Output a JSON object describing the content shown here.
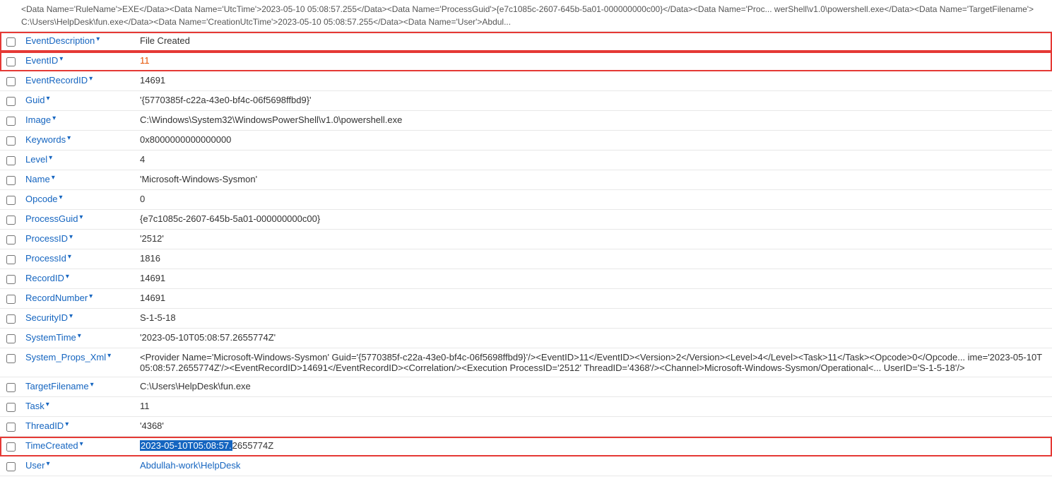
{
  "top_xml": {
    "text": "<Data Name='RuleName'>EXE</Data><Data Name='UtcTime'>2023-05-10 05:08:57.255</Data><Data Name='ProcessGuid'>{e7c1085c-2607-645b-5a01-000000000c00}</Data><Data Name='Proc... werShell\\v1.0\\powershell.exe</Data><Data Name='TargetFilename'>C:\\Users\\HelpDesk\\fun.exe</Data><Data Name='CreationUtcTime'>2023-05-10 05:08:57.255</Data><Data Name='User'>Abdul..."
  },
  "rows": [
    {
      "id": "event-description",
      "name": "EventDescription",
      "value": "File Created",
      "valueClass": "",
      "highlighted": true,
      "checkbox": false
    },
    {
      "id": "event-id",
      "name": "EventID",
      "value": "11",
      "valueClass": "orange",
      "highlighted": true,
      "checkbox": false
    },
    {
      "id": "event-record-id",
      "name": "EventRecordID",
      "value": "14691",
      "valueClass": "",
      "highlighted": false,
      "checkbox": false
    },
    {
      "id": "guid",
      "name": "Guid",
      "value": "'{5770385f-c22a-43e0-bf4c-06f5698ffbd9}'",
      "valueClass": "",
      "highlighted": false,
      "checkbox": false
    },
    {
      "id": "image",
      "name": "Image",
      "value": "C:\\Windows\\System32\\WindowsPowerShell\\v1.0\\powershell.exe",
      "valueClass": "",
      "highlighted": false,
      "checkbox": false
    },
    {
      "id": "keywords",
      "name": "Keywords",
      "value": "0x8000000000000000",
      "valueClass": "",
      "highlighted": false,
      "checkbox": false
    },
    {
      "id": "level",
      "name": "Level",
      "value": "4",
      "valueClass": "",
      "highlighted": false,
      "checkbox": false
    },
    {
      "id": "name",
      "name": "Name",
      "value": "'Microsoft-Windows-Sysmon'",
      "valueClass": "",
      "highlighted": false,
      "checkbox": false
    },
    {
      "id": "opcode",
      "name": "Opcode",
      "value": "0",
      "valueClass": "",
      "highlighted": false,
      "checkbox": false
    },
    {
      "id": "process-guid",
      "name": "ProcessGuid",
      "value": "{e7c1085c-2607-645b-5a01-000000000c00}",
      "valueClass": "",
      "highlighted": false,
      "checkbox": false
    },
    {
      "id": "process-id",
      "name": "ProcessID",
      "value": "'2512'",
      "valueClass": "",
      "highlighted": false,
      "checkbox": false
    },
    {
      "id": "process-id-lower",
      "name": "ProcessId",
      "value": "1816",
      "valueClass": "",
      "highlighted": false,
      "checkbox": false
    },
    {
      "id": "record-id",
      "name": "RecordID",
      "value": "14691",
      "valueClass": "",
      "highlighted": false,
      "checkbox": false
    },
    {
      "id": "record-number",
      "name": "RecordNumber",
      "value": "14691",
      "valueClass": "",
      "highlighted": false,
      "checkbox": false
    },
    {
      "id": "security-id",
      "name": "SecurityID",
      "value": "S-1-5-18",
      "valueClass": "",
      "highlighted": false,
      "checkbox": false
    },
    {
      "id": "system-time",
      "name": "SystemTime",
      "value": "'2023-05-10T05:08:57.2655774Z'",
      "valueClass": "",
      "highlighted": false,
      "checkbox": false
    },
    {
      "id": "system-props-xml",
      "name": "System_Props_Xml",
      "value": "<Provider Name='Microsoft-Windows-Sysmon' Guid='{5770385f-c22a-43e0-bf4c-06f5698ffbd9}'/><EventID>11</EventID><Version>2</Version><Level>4</Level><Task>11</Task><Opcode>0</Opcode... ime='2023-05-10T05:08:57.2655774Z'/><EventRecordID>14691</EventRecordID><Correlation/><Execution ProcessID='2512' ThreadID='4368'/><Channel>Microsoft-Windows-Sysmon/Operational<... UserID='S-1-5-18'/>",
      "valueClass": "",
      "highlighted": false,
      "checkbox": false,
      "multiline": true
    },
    {
      "id": "target-filename",
      "name": "TargetFilename",
      "value": "C:\\Users\\HelpDesk\\fun.exe",
      "valueClass": "",
      "highlighted": false,
      "checkbox": false
    },
    {
      "id": "task",
      "name": "Task",
      "value": "11",
      "valueClass": "",
      "highlighted": false,
      "checkbox": false
    },
    {
      "id": "thread-id",
      "name": "ThreadID",
      "value": "'4368'",
      "valueClass": "",
      "highlighted": false,
      "checkbox": false
    },
    {
      "id": "time-created",
      "name": "TimeCreated",
      "value_highlighted": "2023-05-10T05:08:57.",
      "value_rest": "2655774Z",
      "valueClass": "blue",
      "highlighted": true,
      "checkbox": false
    },
    {
      "id": "user",
      "name": "User",
      "value": "Abdullah-work\\HelpDesk",
      "valueClass": "blue",
      "highlighted": false,
      "checkbox": false
    }
  ],
  "labels": {
    "dropdown_arrow": "▾"
  }
}
